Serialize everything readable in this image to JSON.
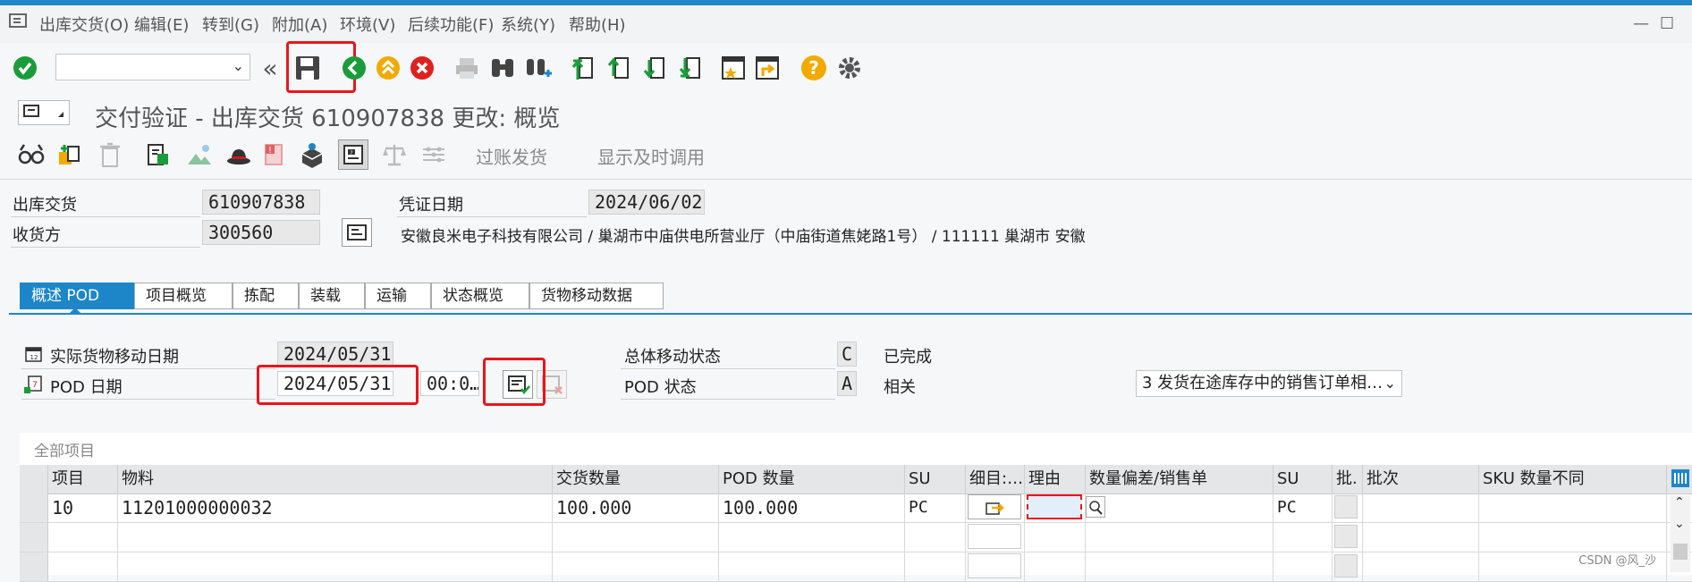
{
  "menu": {
    "items": [
      "出库交货(O)",
      "编辑(E)",
      "转到(G)",
      "附加(A)",
      "环境(V)",
      "后续功能(F)",
      "系统(Y)",
      "帮助(H)"
    ]
  },
  "title": "交付验证 - 出库交货 610907838 更改: 概览",
  "app_toolbar": {
    "post_goods_issue": "过账发货",
    "display_timely_call": "显示及时调用"
  },
  "header": {
    "outbound_delivery_label": "出库交货",
    "outbound_delivery_value": "610907838",
    "doc_date_label": "凭证日期",
    "doc_date_value": "2024/06/02",
    "ship_to_label": "收货方",
    "ship_to_value": "300560",
    "ship_to_address": "安徽良米电子科技有限公司 / 巢湖市中庙供电所营业厅（中庙街道焦姥路1号） / 111111 巢湖市 安徽"
  },
  "tabs": [
    "概述 POD",
    "项目概览",
    "拣配",
    "装载",
    "运输",
    "状态概览",
    "货物移动数据"
  ],
  "pod": {
    "actual_gm_date_label": "实际货物移动日期",
    "actual_gm_date_value": "2024/05/31",
    "pod_date_label": "POD 日期",
    "pod_date_value": "2024/05/31",
    "pod_time_value": "00:0…",
    "overall_mvt_status_label": "总体移动状态",
    "overall_mvt_status_code": "C",
    "overall_mvt_status_text": "已完成",
    "pod_status_label": "POD 状态",
    "pod_status_code": "A",
    "pod_status_text": "相关",
    "reason_select": "3 发货在途库存中的销售订单相…"
  },
  "grid": {
    "title": "全部项目",
    "headers": [
      "项目",
      "物料",
      "交货数量",
      "POD 数量",
      "SU",
      "细目:…",
      "理由",
      "数量偏差/销售单",
      "SU",
      "批.",
      "批次",
      "SKU 数量不同"
    ],
    "rows": [
      {
        "item": "10",
        "material": "11201000000032",
        "delivery_qty": "100.000",
        "pod_qty": "100.000",
        "su": "PC",
        "su2": "PC"
      }
    ]
  },
  "watermark": "CSDN @风_沙",
  "colors": {
    "accent": "#1d86c9",
    "highlight": "#e8161c",
    "ok": "#1a9c3a"
  }
}
